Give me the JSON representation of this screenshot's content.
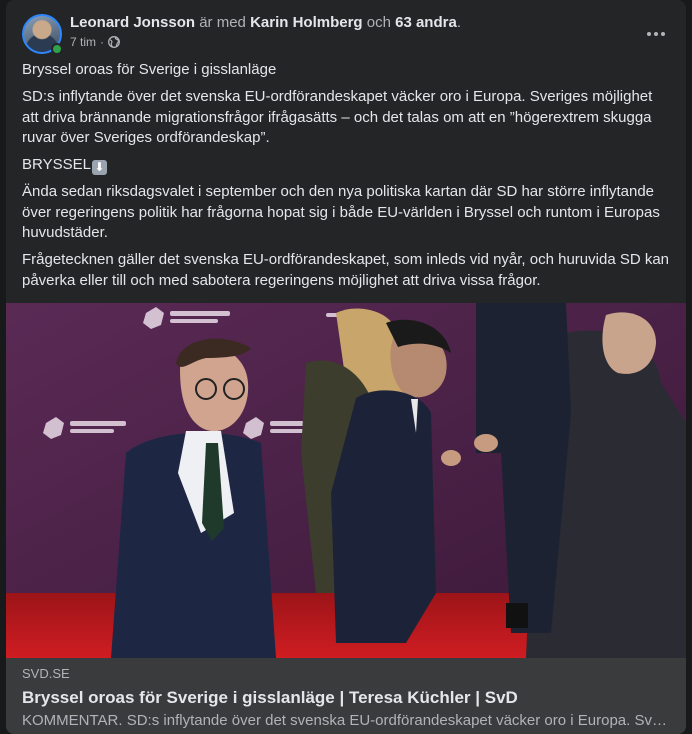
{
  "post": {
    "author": "Leonard Jonsson",
    "with_text": "är med",
    "tagged": "Karin Holmberg",
    "and_text": "och",
    "others": "63 andra",
    "period": ".",
    "time": "7 tim",
    "dot": "·",
    "privacy_icon": "globe-icon",
    "more_icon": "more-options-icon"
  },
  "body": {
    "p1": "Bryssel oroas för Sverige i gisslanläge",
    "p2": "SD:s inflytande över det svenska EU-ordförandeskapet väcker oro i Europa. Sveriges möjlighet att driva brännande migrationsfrågor ifrågasätts – och det talas om att en ”högerextrem skugga ruvar över Sveriges ordförandeskap”.",
    "p3": "BRYSSEL",
    "p3_emoji": "⬇",
    "p4": " Ända sedan riksdagsvalet i september och den nya politiska kartan där SD har större inflytande över regeringens politik har frågorna hopat sig i både EU-världen i Bryssel och runtom i Europas huvudstäder.",
    "p5": "Frågetecknen gäller det svenska EU-ordförandeskapet, som inleds vid nyår, och huruvida SD kan påverka eller till och med sabotera regeringens möjlighet att driva vissa frågor."
  },
  "link": {
    "domain": "SVD.SE",
    "title": "Bryssel oroas för Sverige i gisslanläge | Teresa Küchler | SvD",
    "description": "KOMMENTAR. SD:s inflytande över det svenska EU-ordförandeskapet väcker oro i Europa. Sveriges möjlighet att driva brännande migrationsfrågor ifrågasätts",
    "backdrop_logo_text": "JOINT EXPEDITIONARY FORCE"
  },
  "colors": {
    "card": "#242526",
    "preview": "#3a3b3c",
    "backdrop": "#4a2348",
    "carpet": "#b8161d",
    "online": "#31a24c"
  }
}
